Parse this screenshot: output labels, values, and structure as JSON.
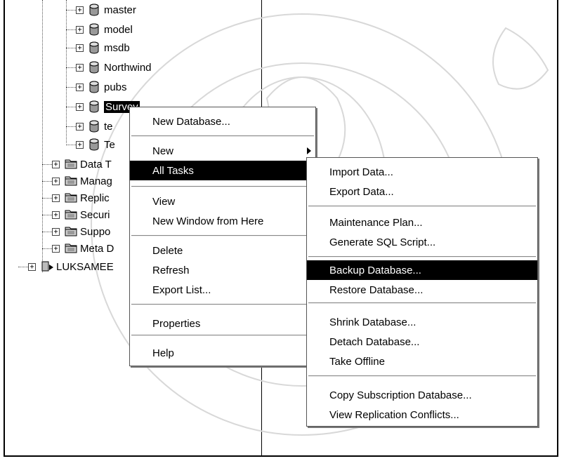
{
  "tree": {
    "databases": [
      {
        "label": "master",
        "icon": "database-icon"
      },
      {
        "label": "model",
        "icon": "database-icon"
      },
      {
        "label": "msdb",
        "icon": "database-icon"
      },
      {
        "label": "Northwind",
        "icon": "database-icon"
      },
      {
        "label": "pubs",
        "icon": "database-icon"
      },
      {
        "label": "Survey",
        "icon": "database-icon",
        "selected": true
      },
      {
        "label": "te",
        "icon": "database-icon"
      },
      {
        "label": "Te",
        "icon": "database-icon"
      }
    ],
    "folders": [
      {
        "label": "Data T",
        "icon": "folder-icon"
      },
      {
        "label": "Manag",
        "icon": "folder-icon"
      },
      {
        "label": "Replic",
        "icon": "folder-icon"
      },
      {
        "label": "Securi",
        "icon": "folder-icon"
      },
      {
        "label": "Suppo",
        "icon": "folder-icon"
      },
      {
        "label": "Meta D",
        "icon": "folder-icon"
      }
    ],
    "server": {
      "label": "LUKSAMEE",
      "icon": "server-icon"
    },
    "expander_glyph": "+"
  },
  "context_menu": {
    "items": [
      {
        "label": "New Database..."
      },
      {
        "label": "New",
        "submenu": true
      },
      {
        "label": "All Tasks",
        "submenu": true,
        "highlighted": true
      },
      {
        "label": "View",
        "submenu": true
      },
      {
        "label": "New Window from Here"
      },
      {
        "label": "Delete"
      },
      {
        "label": "Refresh"
      },
      {
        "label": "Export List..."
      },
      {
        "label": "Properties"
      },
      {
        "label": "Help"
      }
    ]
  },
  "submenu": {
    "items": [
      {
        "label": "Import Data..."
      },
      {
        "label": "Export Data..."
      },
      {
        "label": "Maintenance Plan..."
      },
      {
        "label": "Generate SQL Script..."
      },
      {
        "label": "Backup Database...",
        "highlighted": true
      },
      {
        "label": "Restore Database..."
      },
      {
        "label": "Shrink Database..."
      },
      {
        "label": "Detach Database..."
      },
      {
        "label": "Take Offline"
      },
      {
        "label": "Copy Subscription Database..."
      },
      {
        "label": "View Replication Conflicts..."
      }
    ]
  },
  "colors": {
    "highlight": "#000000",
    "watermark": "#d8d8d8"
  }
}
